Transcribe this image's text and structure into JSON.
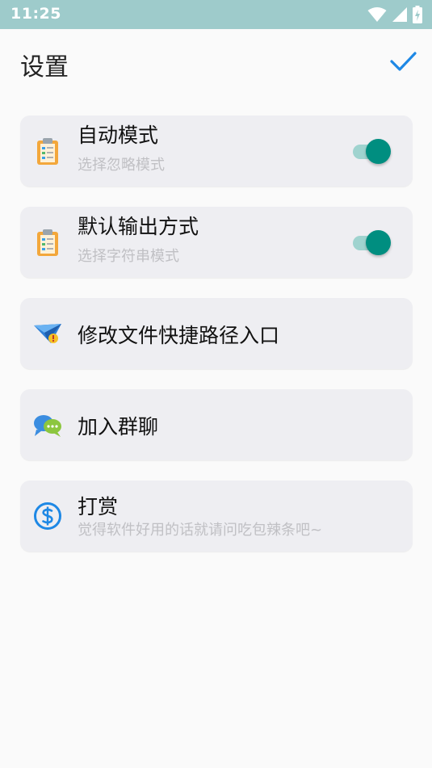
{
  "status_bar": {
    "time": "11:25"
  },
  "header": {
    "title": "设置",
    "confirm_icon": "checkmark-icon"
  },
  "settings": {
    "auto_mode": {
      "title": "自动模式",
      "subtitle": "选择忽略模式",
      "enabled": true,
      "icon": "clipboard-icon"
    },
    "default_output": {
      "title": "默认输出方式",
      "subtitle": "选择字符串模式",
      "enabled": true,
      "icon": "clipboard-icon"
    },
    "edit_shortcut": {
      "title": "修改文件快捷路径入口",
      "icon": "paper-plane-icon"
    },
    "join_group": {
      "title": "加入群聊",
      "icon": "chat-bubbles-icon"
    },
    "donate": {
      "title": "打赏",
      "subtitle": "觉得软件好用的话就请问吃包辣条吧~",
      "icon": "dollar-icon"
    }
  },
  "colors": {
    "accent": "#1e88e5",
    "toggle_on": "#008e80",
    "card_bg": "#eeeef2",
    "status_bar": "#9ecbcb"
  }
}
